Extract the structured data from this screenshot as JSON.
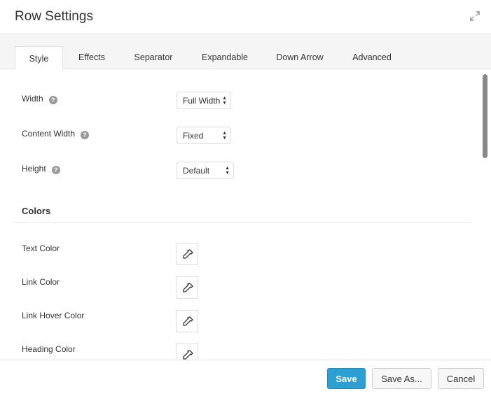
{
  "header": {
    "title": "Row Settings",
    "expand_icon": "expand-icon"
  },
  "tabs": [
    {
      "label": "Style",
      "active": true
    },
    {
      "label": "Effects"
    },
    {
      "label": "Separator"
    },
    {
      "label": "Expandable"
    },
    {
      "label": "Down Arrow"
    },
    {
      "label": "Advanced"
    }
  ],
  "fields": [
    {
      "label": "Width",
      "value": "Full Width"
    },
    {
      "label": "Content Width",
      "value": "Fixed"
    },
    {
      "label": "Height",
      "value": "Default"
    }
  ],
  "colors": {
    "title": "Colors",
    "items": [
      {
        "label": "Text Color"
      },
      {
        "label": "Link Color"
      },
      {
        "label": "Link Hover Color"
      },
      {
        "label": "Heading Color"
      }
    ]
  },
  "footer": {
    "save": "Save",
    "save_as": "Save As...",
    "cancel": "Cancel"
  },
  "accent": "#2e9fd2"
}
